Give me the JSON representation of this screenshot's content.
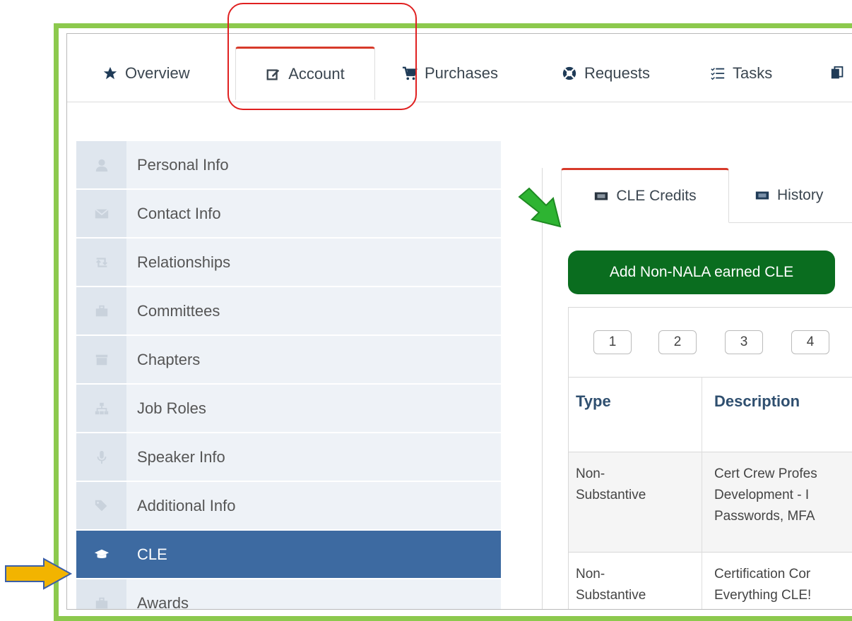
{
  "top_tabs": [
    {
      "label": "Overview",
      "icon": "star-icon"
    },
    {
      "label": "Account",
      "icon": "edit-icon",
      "active": true
    },
    {
      "label": "Purchases",
      "icon": "cart-icon"
    },
    {
      "label": "Requests",
      "icon": "lifebuoy-icon"
    },
    {
      "label": "Tasks",
      "icon": "list-icon"
    }
  ],
  "sidebar": {
    "items": [
      {
        "label": "Personal Info",
        "icon": "user-icon"
      },
      {
        "label": "Contact Info",
        "icon": "envelope-icon"
      },
      {
        "label": "Relationships",
        "icon": "retweet-icon"
      },
      {
        "label": "Committees",
        "icon": "briefcase-icon"
      },
      {
        "label": "Chapters",
        "icon": "archive-icon"
      },
      {
        "label": "Job Roles",
        "icon": "sitemap-icon"
      },
      {
        "label": "Speaker Info",
        "icon": "microphone-icon"
      },
      {
        "label": "Additional Info",
        "icon": "tags-icon"
      },
      {
        "label": "CLE",
        "icon": "graduation-cap-icon",
        "active": true
      },
      {
        "label": "Awards",
        "icon": "briefcase-icon"
      }
    ]
  },
  "sub_tabs": [
    {
      "label": "CLE Credits",
      "icon": "ticket-icon",
      "active": true
    },
    {
      "label": "History",
      "icon": "ticket-icon"
    }
  ],
  "add_button_label": "Add Non-NALA earned CLE",
  "pager": [
    "1",
    "2",
    "3",
    "4"
  ],
  "table": {
    "headers": [
      "Type",
      "Description"
    ],
    "rows": [
      {
        "type": [
          "Non-",
          "Substantive"
        ],
        "description": [
          "Cert Crew Profes",
          "Development - I",
          "Passwords, MFA"
        ]
      },
      {
        "type": [
          "Non-",
          "Substantive"
        ],
        "description": [
          "Certification Cor",
          "Everything CLE!"
        ]
      }
    ]
  },
  "colors": {
    "frame": "#8cc94d",
    "active_nav": "#3d6aa1",
    "button": "#0a6d1f",
    "highlight": "#e02020",
    "arrow_green": "#2eb432",
    "arrow_yellow": "#f2b400"
  }
}
